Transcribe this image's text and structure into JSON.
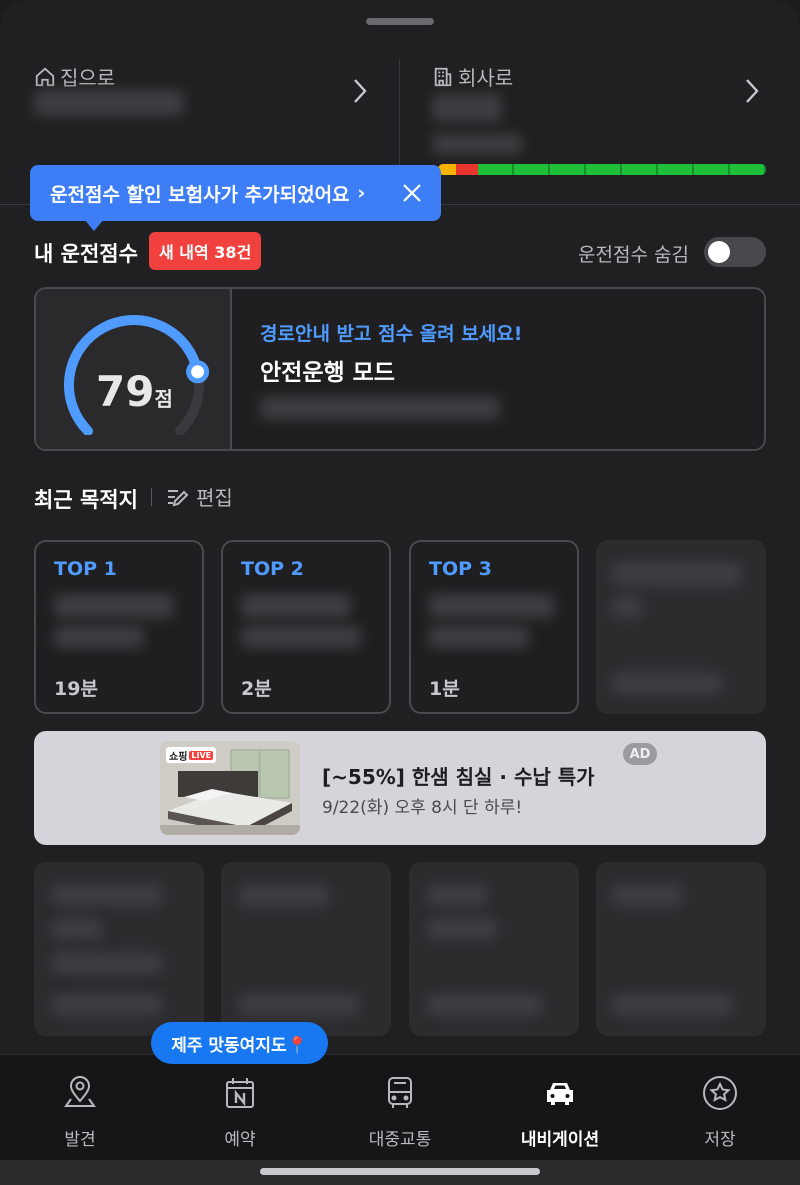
{
  "quick_destinations": {
    "home": {
      "label": "집으로"
    },
    "work": {
      "label": "회사로"
    }
  },
  "traffic_colors": [
    "#f4b400",
    "#e8352e",
    "#1fbf3a"
  ],
  "tooltip": {
    "text": "운전점수 할인 보험사가 추가되었어요",
    "chevron": "›"
  },
  "driving_score": {
    "title": "내 운전점수",
    "new_badge": "새 내역 38건",
    "hide_label": "운전점수 숨김",
    "score": "79",
    "score_unit": "점",
    "gauge_fraction": 0.79,
    "promo": "경로안내 받고 점수 올려 보세요!",
    "mode": "안전운행 모드"
  },
  "recent": {
    "title": "최근 목적지",
    "edit_label": "편집",
    "items": [
      {
        "rank": "TOP 1",
        "time": "19분"
      },
      {
        "rank": "TOP 2",
        "time": "2분"
      },
      {
        "rank": "TOP 3",
        "time": "1분"
      }
    ]
  },
  "ad": {
    "shop_badge": "쇼핑",
    "live_badge": "LIVE",
    "title": "[~55%] 한샘 침실 · 수납 특가",
    "subtitle": "9/22(화) 오후 8시 단 하루!",
    "tag": "AD"
  },
  "event_bubble": "제주 맛동여지도📍",
  "tabs": [
    {
      "label": "발견",
      "icon": "map-pin-icon",
      "active": false
    },
    {
      "label": "예약",
      "icon": "calendar-icon",
      "active": false
    },
    {
      "label": "대중교통",
      "icon": "bus-icon",
      "active": false
    },
    {
      "label": "내비게이션",
      "icon": "car-icon",
      "active": true
    },
    {
      "label": "저장",
      "icon": "star-icon",
      "active": false
    }
  ],
  "accent_color": "#3d7ef6"
}
